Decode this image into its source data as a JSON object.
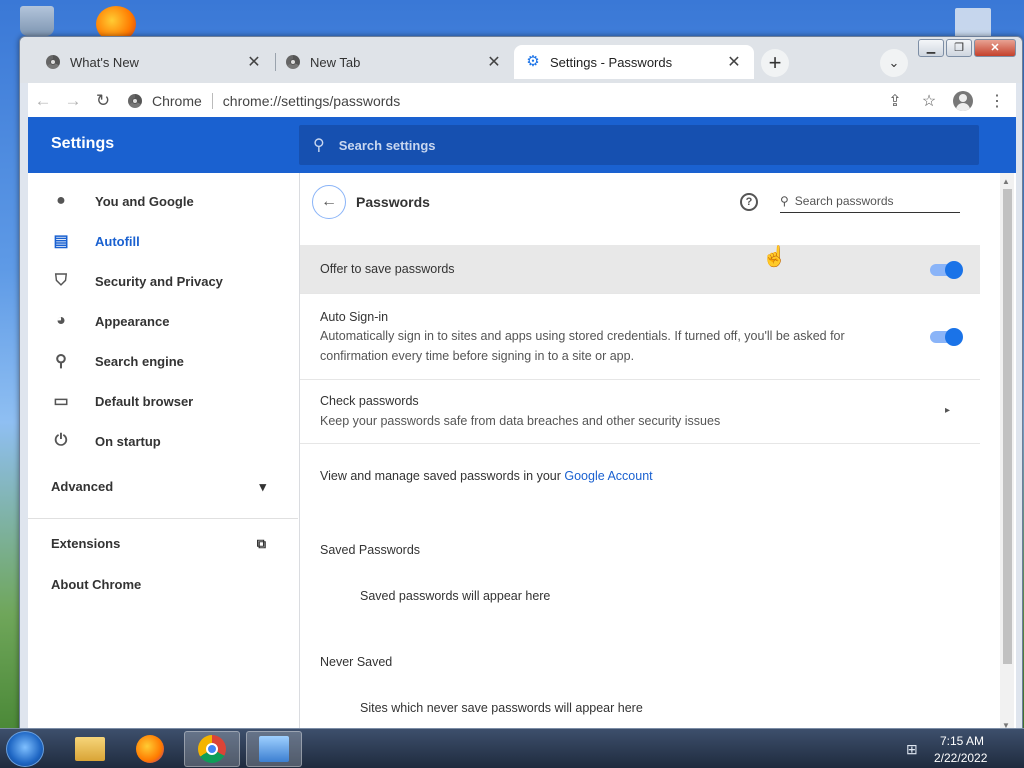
{
  "window": {
    "tabs": [
      {
        "title": "What's New",
        "close": "✕"
      },
      {
        "title": "New Tab",
        "close": "✕"
      },
      {
        "title": "Settings - Passwords",
        "close": "✕"
      }
    ],
    "new_tab_glyph": "+",
    "tab_search_glyph": "⌄",
    "controls": {
      "minimize": "▁",
      "restore": "❐",
      "close": "✕"
    }
  },
  "toolbar": {
    "back": "←",
    "forward": "→",
    "reload": "↻",
    "origin": "Chrome",
    "url": "chrome://settings/passwords",
    "share": "⇪",
    "bookmark": "☆",
    "menu": "⋮"
  },
  "settings": {
    "title": "Settings",
    "search_placeholder": "Search settings",
    "search_glyph": "⚲",
    "nav": [
      {
        "label": "You and Google",
        "icon": "person-icon",
        "glyph": "●"
      },
      {
        "label": "Autofill",
        "icon": "clipboard-icon",
        "glyph": "▤"
      },
      {
        "label": "Security and Privacy",
        "icon": "shield-icon",
        "glyph": "⛉"
      },
      {
        "label": "Appearance",
        "icon": "palette-icon",
        "glyph": "◕"
      },
      {
        "label": "Search engine",
        "icon": "search-icon",
        "glyph": "⚲"
      },
      {
        "label": "Default browser",
        "icon": "browser-icon",
        "glyph": "▭"
      },
      {
        "label": "On startup",
        "icon": "power-icon",
        "glyph": "⏻"
      }
    ],
    "active_nav": "Autofill",
    "advanced_label": "Advanced",
    "advanced_glyph": "▾",
    "extensions_label": "Extensions",
    "extensions_glyph": "⧉",
    "about_label": "About Chrome"
  },
  "passwords": {
    "back_glyph": "←",
    "title": "Passwords",
    "help_glyph": "?",
    "search_placeholder": "Search passwords",
    "search_glyph": "⚲",
    "offer_to_save": {
      "title": "Offer to save passwords",
      "enabled": true
    },
    "auto_signin": {
      "title": "Auto Sign-in",
      "description": "Automatically sign in to sites and apps using stored credentials. If turned off, you'll be asked for confirmation every time before signing in to a site or app.",
      "enabled": true
    },
    "check_passwords": {
      "title": "Check passwords",
      "description": "Keep your passwords safe from data breaches and other security issues",
      "chevron": "▸"
    },
    "manage_text": "View and manage saved passwords in your ",
    "manage_link": "Google Account",
    "saved_heading": "Saved Passwords",
    "saved_empty": "Saved passwords will appear here",
    "never_heading": "Never Saved",
    "never_empty": "Sites which never save passwords will appear here"
  },
  "cursor_glyph": "☝",
  "taskbar": {
    "time": "7:15 AM",
    "date": "2/22/2022",
    "network_glyph": "⊞"
  },
  "colors": {
    "accent": "#1a61d0",
    "header": "#1a61d0",
    "toggle_on": "#1a73e8"
  }
}
